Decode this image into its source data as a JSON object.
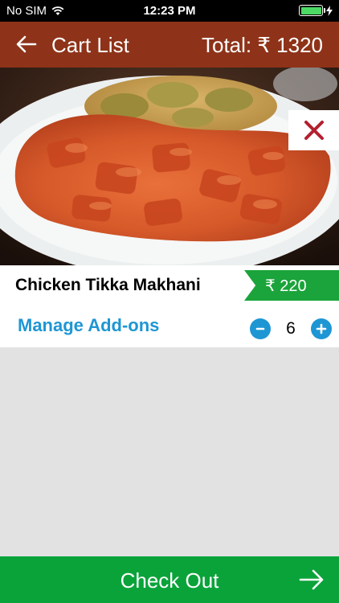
{
  "status_bar": {
    "carrier": "No SIM",
    "time": "12:23 PM"
  },
  "header": {
    "title": "Cart List",
    "total_label": "Total:",
    "total_value": "₹ 1320",
    "back_icon": "back-arrow-icon",
    "color": "#8e3319"
  },
  "item": {
    "name": "Chicken Tikka Makhani",
    "price": "₹ 220",
    "manage_addons": "Manage Add-ons",
    "quantity": "6",
    "minus": "-",
    "plus": "+",
    "remove_icon": "close-icon",
    "price_color": "#1aa43b",
    "accent": "#1e96d4",
    "remove_color": "#b3202f"
  },
  "footer": {
    "checkout_label": "Check Out",
    "arrow_icon": "arrow-right-icon",
    "color": "#0aa33a"
  }
}
